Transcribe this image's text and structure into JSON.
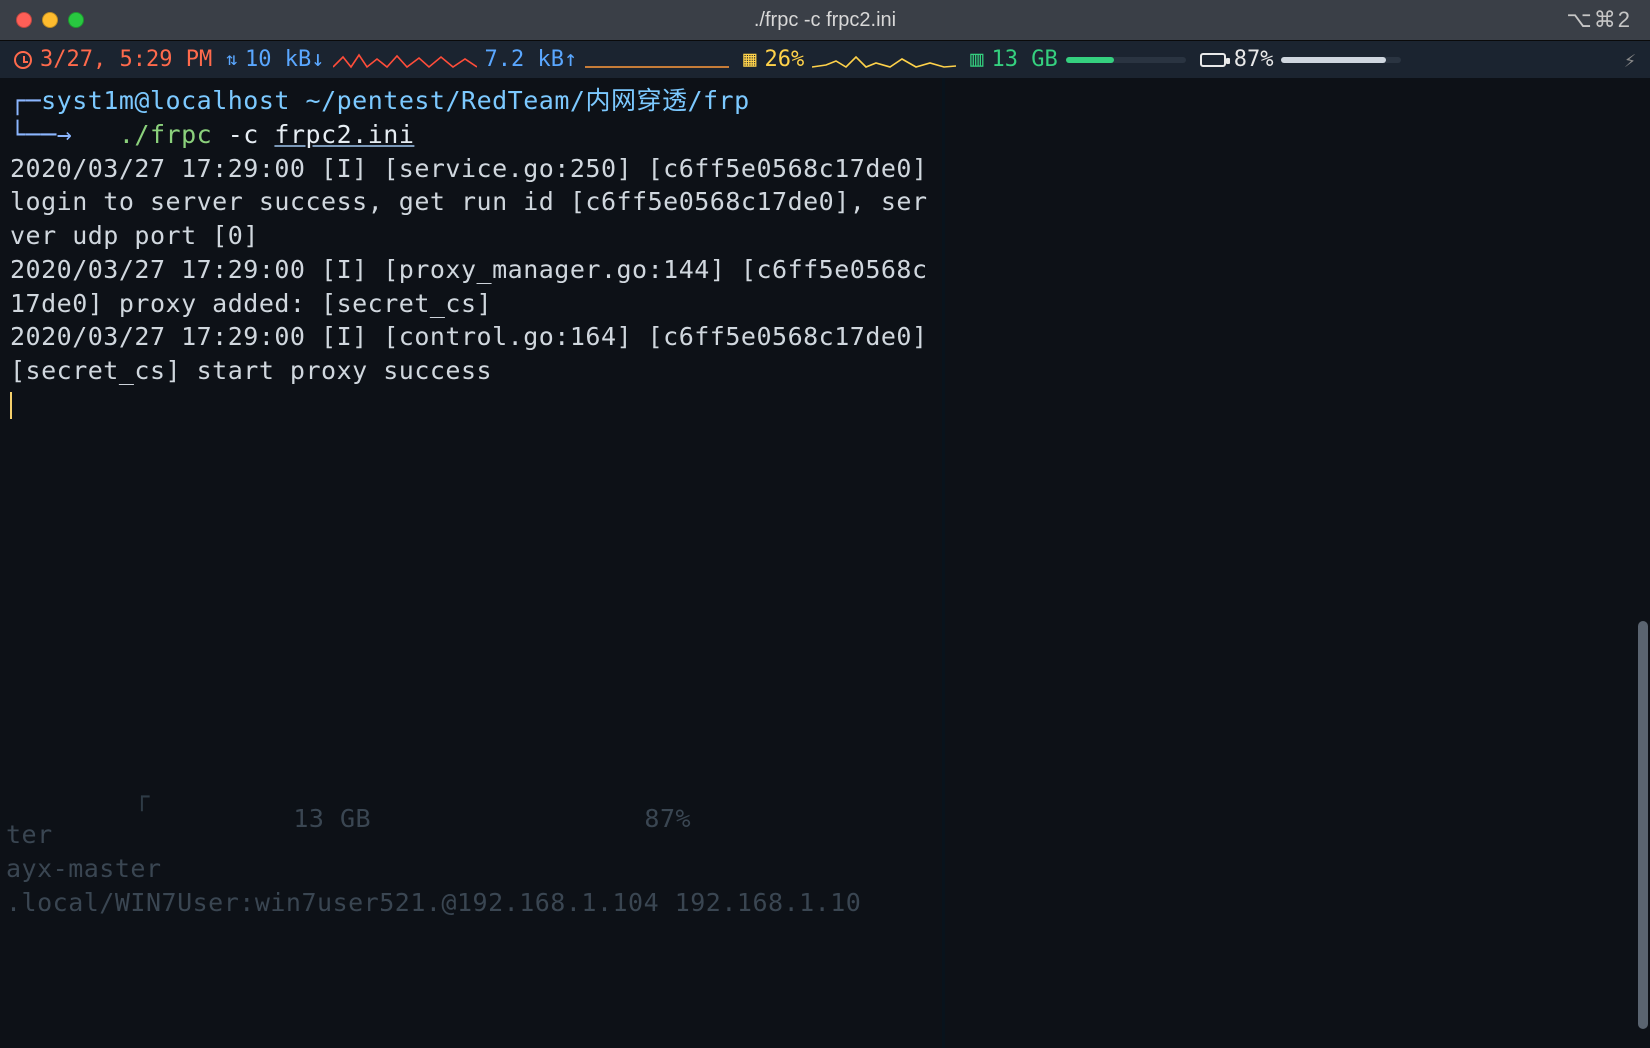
{
  "window": {
    "title": "./frpc -c frpc2.ini",
    "shortcut_hint": "⌥⌘2"
  },
  "status": {
    "time": "3/27, 5:29 PM",
    "net_down": "10 kB↓",
    "net_up": "7.2 kB↑",
    "cpu": "26%",
    "mem": "13 GB",
    "battery": "87%",
    "cpu_bar_pct": 26,
    "mem_bar_pct": 40,
    "bat_bar_pct": 87
  },
  "prompt": {
    "user": "syst1m",
    "at": "@",
    "host": "localhost",
    "path": "~/pentest/RedTeam/内网穿透/frp",
    "arrow": "→",
    "cmd_bin": "./frpc",
    "cmd_flag": "-c",
    "cmd_file": "frpc2.ini"
  },
  "log_lines": [
    "2020/03/27 17:29:00 [I] [service.go:250] [c6ff5e0568c17de0] login to server success, get run id [c6ff5e0568c17de0], server udp port [0]",
    "2020/03/27 17:29:00 [I] [proxy_manager.go:144] [c6ff5e0568c17de0] proxy added: [secret_cs]",
    "2020/03/27 17:29:00 [I] [control.go:164] [c6ff5e0568c17de0] [secret_cs] start proxy success"
  ],
  "ghost": {
    "line1": "ter",
    "line2": "ayx-master",
    "line3": ".local/WIN7User:win7user521.@192.168.1.104 192.168.1.10",
    "stats": "13 GB",
    "bat": "87%"
  }
}
